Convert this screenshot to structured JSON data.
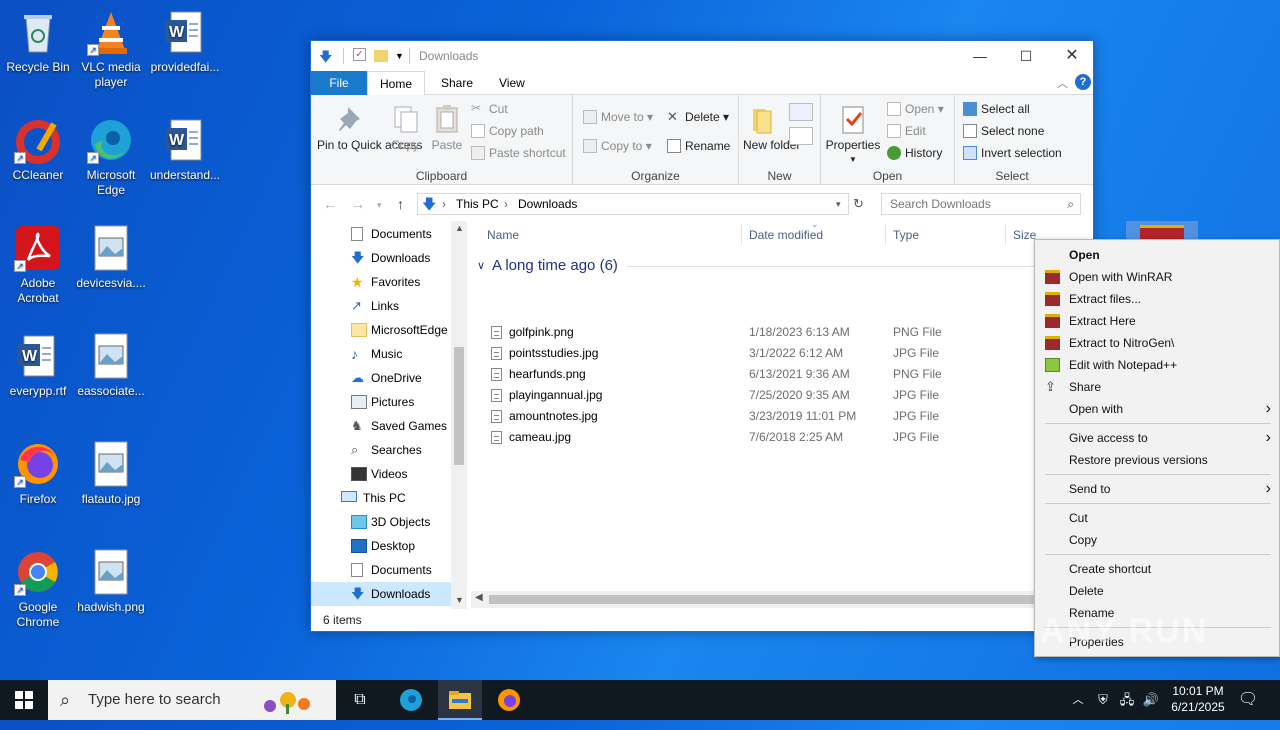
{
  "desktop": {
    "icons": [
      {
        "label": "Recycle Bin",
        "icon": "recycle-bin-icon"
      },
      {
        "label": "VLC media player",
        "icon": "vlc-icon"
      },
      {
        "label": "providedfai...",
        "icon": "word-doc-icon"
      },
      {
        "label": "CCleaner",
        "icon": "ccleaner-icon"
      },
      {
        "label": "Microsoft Edge",
        "icon": "edge-icon"
      },
      {
        "label": "understand...",
        "icon": "word-doc-icon"
      },
      {
        "label": "Adobe Acrobat",
        "icon": "acrobat-icon"
      },
      {
        "label": "devicesvia....",
        "icon": "image-file-icon"
      },
      {
        "label": "everypp.rtf",
        "icon": "word-doc-icon"
      },
      {
        "label": "eassociate...",
        "icon": "image-file-icon"
      },
      {
        "label": "Firefox",
        "icon": "firefox-icon"
      },
      {
        "label": "flatauto.jpg",
        "icon": "image-file-icon"
      },
      {
        "label": "Google Chrome",
        "icon": "chrome-icon"
      },
      {
        "label": "hadwish.png",
        "icon": "image-file-icon"
      }
    ]
  },
  "explorer": {
    "title": "Downloads",
    "tabs": {
      "file": "File",
      "home": "Home",
      "share": "Share",
      "view": "View"
    },
    "ribbon": {
      "clipboard": {
        "pin": "Pin to Quick access",
        "copy": "Copy",
        "paste": "Paste",
        "cut": "Cut",
        "copy_path": "Copy path",
        "paste_shortcut": "Paste shortcut",
        "label": "Clipboard"
      },
      "organize": {
        "move_to": "Move to",
        "delete": "Delete",
        "copy_to": "Copy to",
        "rename": "Rename",
        "label": "Organize"
      },
      "new": {
        "new_folder": "New folder",
        "label": "New"
      },
      "open": {
        "properties": "Properties",
        "open": "Open",
        "edit": "Edit",
        "history": "History",
        "label": "Open"
      },
      "select": {
        "select_all": "Select all",
        "select_none": "Select none",
        "invert": "Invert selection",
        "label": "Select"
      }
    },
    "address": {
      "this_pc": "This PC",
      "downloads": "Downloads"
    },
    "search_placeholder": "Search Downloads",
    "nav": [
      {
        "label": "Documents"
      },
      {
        "label": "Downloads"
      },
      {
        "label": "Favorites"
      },
      {
        "label": "Links"
      },
      {
        "label": "MicrosoftEdge"
      },
      {
        "label": "Music"
      },
      {
        "label": "OneDrive"
      },
      {
        "label": "Pictures"
      },
      {
        "label": "Saved Games"
      },
      {
        "label": "Searches"
      },
      {
        "label": "Videos"
      },
      {
        "label": "This PC"
      },
      {
        "label": "3D Objects"
      },
      {
        "label": "Desktop"
      },
      {
        "label": "Documents"
      },
      {
        "label": "Downloads"
      }
    ],
    "columns": {
      "name": "Name",
      "date": "Date modified",
      "type": "Type",
      "size": "Size"
    },
    "group": "A long time ago (6)",
    "files": [
      {
        "name": "golfpink.png",
        "date": "1/18/2023 6:13 AM",
        "type": "PNG File"
      },
      {
        "name": "pointsstudies.jpg",
        "date": "3/1/2022 6:12 AM",
        "type": "JPG File"
      },
      {
        "name": "hearfunds.png",
        "date": "6/13/2021 9:36 AM",
        "type": "PNG File"
      },
      {
        "name": "playingannual.jpg",
        "date": "7/25/2020 9:35 AM",
        "type": "JPG File"
      },
      {
        "name": "amountnotes.jpg",
        "date": "3/23/2019 11:01 PM",
        "type": "JPG File"
      },
      {
        "name": "cameau.jpg",
        "date": "7/6/2018 2:25 AM",
        "type": "JPG File"
      }
    ],
    "status": "6 items"
  },
  "context_menu": {
    "open": "Open",
    "open_winrar": "Open with WinRAR",
    "extract_files": "Extract files...",
    "extract_here": "Extract Here",
    "extract_to": "Extract to NitroGen\\",
    "edit_npp": "Edit with Notepad++",
    "share": "Share",
    "open_with": "Open with",
    "give_access": "Give access to",
    "restore": "Restore previous versions",
    "send_to": "Send to",
    "cut": "Cut",
    "copy": "Copy",
    "create_shortcut": "Create shortcut",
    "delete": "Delete",
    "rename": "Rename",
    "properties": "Properties"
  },
  "taskbar": {
    "search_placeholder": "Type here to search",
    "time": "10:01 PM",
    "date": "6/21/2025"
  },
  "watermark": "ANY RUN"
}
